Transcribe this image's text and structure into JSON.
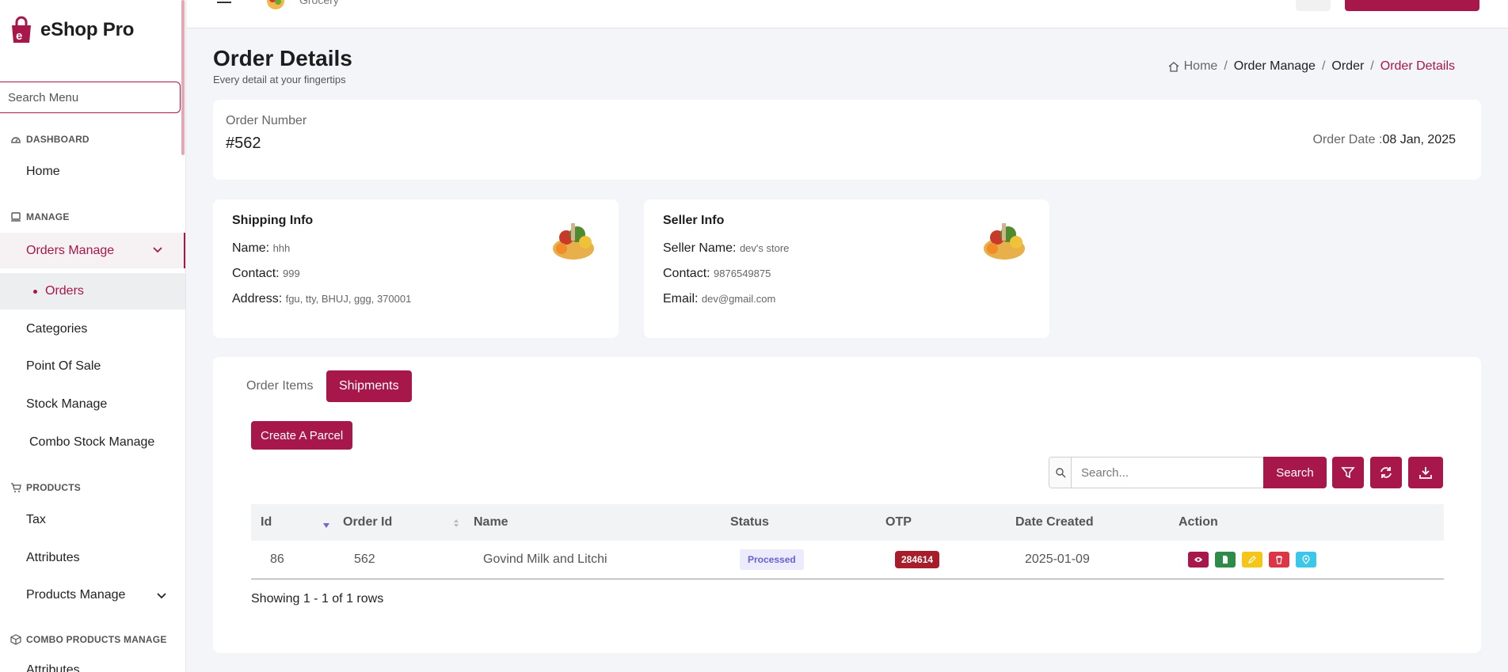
{
  "brand": {
    "name": "eShop Pro"
  },
  "sidebar": {
    "search_placeholder": "Search Menu",
    "sections": {
      "dashboard": "DASHBOARD",
      "manage": "MANAGE",
      "products": "PRODUCTS",
      "combo": "COMBO PRODUCTS MANAGE"
    },
    "items": {
      "home": "Home",
      "orders_manage": "Orders Manage",
      "orders": "Orders",
      "categories": "Categories",
      "pos": "Point Of Sale",
      "stock": "Stock Manage",
      "combo_stock": "Combo Stock Manage",
      "tax": "Tax",
      "attributes": "Attributes",
      "products_manage": "Products Manage",
      "combo_attributes": "Attributes"
    }
  },
  "header": {
    "store_name": "Grocery"
  },
  "page": {
    "title": "Order Details",
    "subtitle": "Every detail at your fingertips",
    "breadcrumb": {
      "home": "Home",
      "c1": "Order Manage",
      "c2": "Order",
      "current": "Order Details",
      "sep": "/"
    }
  },
  "order": {
    "number_label": "Order Number",
    "number": "#562",
    "date_label": "Order Date :",
    "date": "08 Jan, 2025"
  },
  "shipping": {
    "title": "Shipping Info",
    "name_label": "Name:",
    "name": "hhh",
    "contact_label": "Contact:",
    "contact": "999",
    "address_label": "Address:",
    "address": "fgu, tty, BHUJ, ggg, 370001"
  },
  "seller": {
    "title": "Seller Info",
    "name_label": "Seller Name:",
    "name": "dev's store",
    "contact_label": "Contact:",
    "contact": "9876549875",
    "email_label": "Email:",
    "email": "dev@gmail.com"
  },
  "tabs": {
    "order_items": "Order Items",
    "shipments": "Shipments"
  },
  "create_parcel": "Create A Parcel",
  "table": {
    "search_placeholder": "Search...",
    "search_button": "Search",
    "columns": {
      "id": "Id",
      "order_id": "Order Id",
      "name": "Name",
      "status": "Status",
      "otp": "OTP",
      "date_created": "Date Created",
      "action": "Action"
    },
    "row": {
      "id": "86",
      "order_id": "562",
      "name": "Govind Milk and Litchi",
      "status": "Processed",
      "otp": "284614",
      "date_created": "2025-01-09"
    },
    "showing": "Showing 1 - 1 of 1 rows"
  },
  "colors": {
    "primary": "#a8174a",
    "view": "#a8174a",
    "doc": "#2e8b4a",
    "edit": "#f5c518",
    "delete": "#dc3545",
    "location": "#3cc6e8"
  }
}
